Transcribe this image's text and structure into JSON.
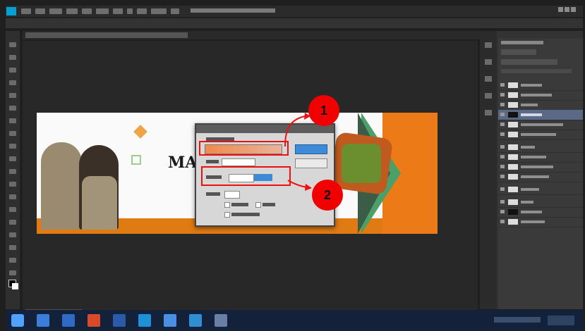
{
  "colors": {
    "app_accent": "#00a2d6",
    "highlight_red": "#e11111",
    "callout_red": "#f00000",
    "banner_orange": "#e07a12",
    "banner_green": "#4ba06a",
    "ok_blue": "#3d8bd6",
    "taskbar": "#13223a"
  },
  "icons": {
    "app_logo": "photoshop-logo-icon",
    "start": "windows-start-icon"
  },
  "banner": {
    "headline": "MA"
  },
  "callouts": [
    {
      "number": "1"
    },
    {
      "number": "2"
    }
  ]
}
